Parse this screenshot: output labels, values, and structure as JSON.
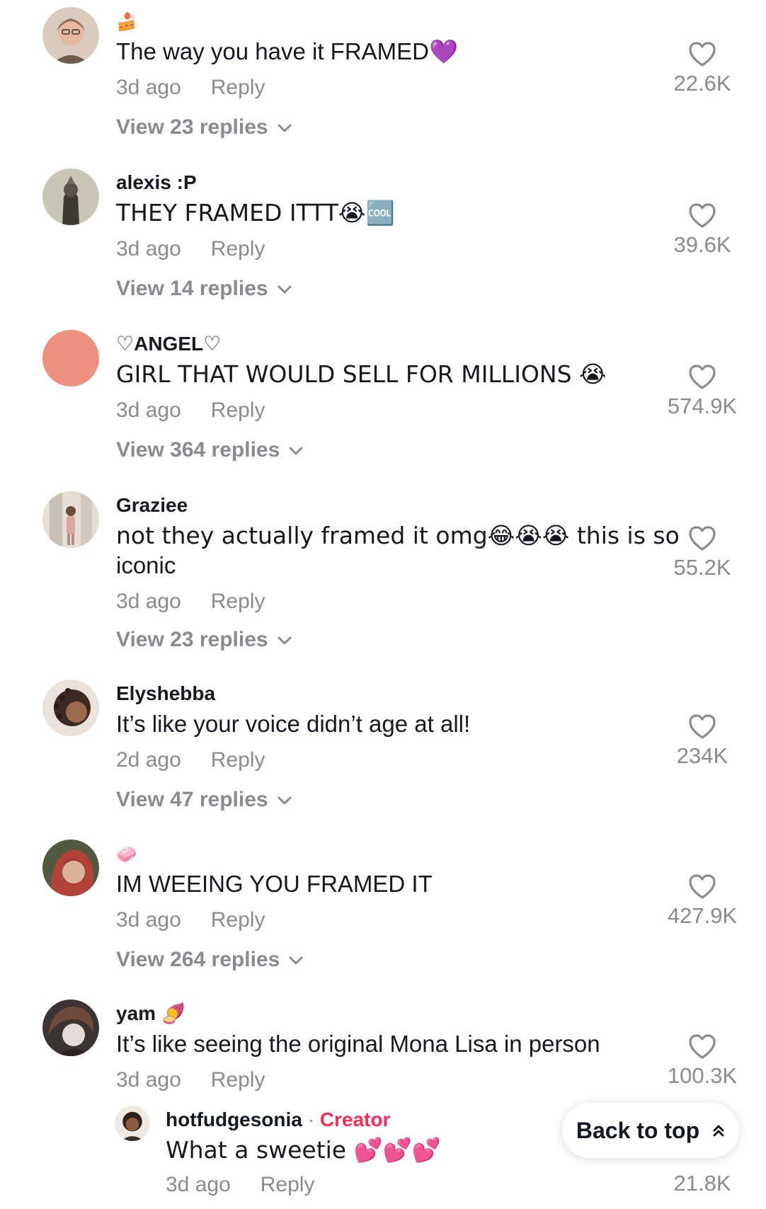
{
  "comments": [
    {
      "username": "",
      "username_emoji": "🍰",
      "text": "The way you have it FRAMED💜",
      "time": "3d ago",
      "reply_label": "Reply",
      "view_replies": "View 23 replies",
      "likes": "22.6K",
      "avatar_color": "#c9b8a8"
    },
    {
      "username": "alexis :P",
      "text": "THEY FRAMED ITTT😭🆒",
      "time": "3d ago",
      "reply_label": "Reply",
      "view_replies": "View 14 replies",
      "likes": "39.6K",
      "avatar_color": "#8f8a78"
    },
    {
      "username": "♡ANGEL♡",
      "text": "GIRL THAT WOULD SELL FOR MILLIONS 😭",
      "time": "3d ago",
      "reply_label": "Reply",
      "view_replies": "View 364 replies",
      "likes": "574.9K",
      "avatar_color": "#ee9080"
    },
    {
      "username": "Graziee",
      "text_line1": "not they actually framed it omg😂😭😭 this is so",
      "text_line2": "iconic",
      "time": "3d ago",
      "reply_label": "Reply",
      "view_replies": "View 23 replies",
      "likes": "55.2K",
      "avatar_color": "#d8cfc6"
    },
    {
      "username": "Elyshebba",
      "text": "It’s like your voice didn’t age at all!",
      "time": "2d ago",
      "reply_label": "Reply",
      "view_replies": "View 47 replies",
      "likes": "234K",
      "avatar_color": "#5a4334"
    },
    {
      "username": "",
      "username_emoji": "🧼",
      "text": "IM WEEING YOU FRAMED IT",
      "time": "3d ago",
      "reply_label": "Reply",
      "view_replies": "View 264 replies",
      "likes": "427.9K",
      "avatar_color": "#6d4a3c"
    },
    {
      "username": "yam",
      "username_emoji": "🍠",
      "text": "It’s like seeing the original Mona Lisa in person",
      "time": "3d ago",
      "reply_label": "Reply",
      "likes": "100.3K",
      "avatar_color": "#4a4140"
    }
  ],
  "reply": {
    "username": "hotfudgesonia",
    "separator": "·",
    "creator_badge": "Creator",
    "text": "What a sweetie 💕💕💕",
    "time": "3d ago",
    "reply_label": "Reply",
    "likes": "21.8K",
    "avatar_color": "#7a5a4a"
  },
  "back_to_top": {
    "label": "Back to top",
    "icon": "double-chevron-up-icon"
  },
  "colors": {
    "text_primary": "#161823",
    "text_secondary": "#8a8b91",
    "creator": "#fe2c55"
  }
}
